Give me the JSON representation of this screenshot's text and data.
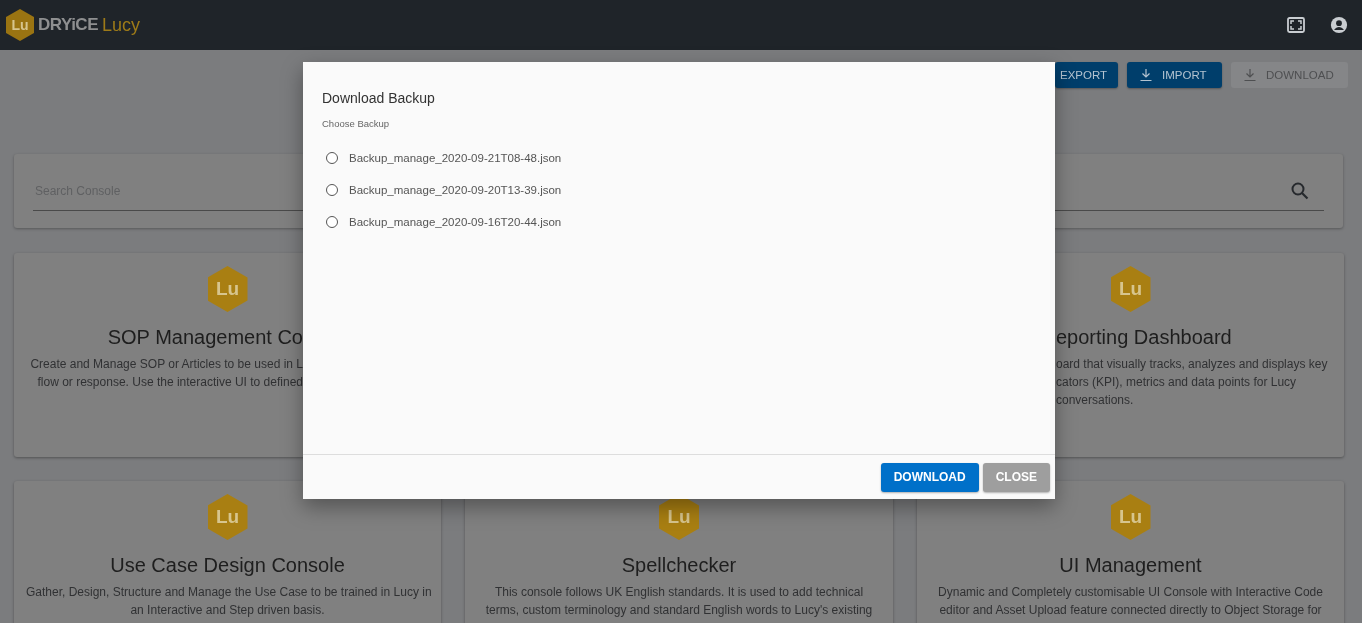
{
  "header": {
    "logo_text": "Lu",
    "brand": "DRYiCE",
    "product": "Lucy"
  },
  "toolbar": [
    {
      "label": "EXPORT",
      "kind": "plain",
      "disabled": false
    },
    {
      "label": "IMPORT",
      "kind": "icon",
      "disabled": false
    },
    {
      "label": "DOWNLOAD",
      "kind": "icon",
      "disabled": true
    }
  ],
  "search": {
    "placeholder": "Search Console"
  },
  "cards_row_1": [
    {
      "logo_text": "Lu",
      "title": "SOP Management Co",
      "description_lines": [
        "Create and Manage SOP or Articles to be used in L",
        "flow or response. Use the interactive UI to defined"
      ]
    },
    {
      "logo_text": "Lu",
      "title": "eporting Dashboard",
      "description_lines": [
        "oard that visually tracks, analyzes and displays key",
        "cators (KPI), metrics and data points for Lucy",
        "conversations."
      ]
    }
  ],
  "cards_row_2": [
    {
      "logo_text": "Lu",
      "title": "Use Case Design Console",
      "description_lines": [
        "Gather, Design, Structure and Manage the Use Case to be trained in Lucy in",
        "an Interactive and Step driven basis."
      ]
    },
    {
      "logo_text": "Lu",
      "title": "Spellchecker",
      "description_lines": [
        "This console follows UK English standards. It is used to add technical",
        "terms, custom terminology and standard English words to Lucy's existing"
      ]
    },
    {
      "logo_text": "Lu",
      "title": "UI Management",
      "description_lines": [
        "Dynamic and Completely customisable UI Console with Interactive Code",
        "editor and Asset Upload feature connected directly to Object Storage for"
      ]
    }
  ],
  "dialog": {
    "title": "Download Backup",
    "label": "Choose Backup",
    "options": [
      {
        "label": "Backup_manage_2020-09-21T08-48.json",
        "selected": false
      },
      {
        "label": "Backup_manage_2020-09-20T13-39.json",
        "selected": false
      },
      {
        "label": "Backup_manage_2020-09-16T20-44.json",
        "selected": false
      }
    ],
    "buttons": [
      {
        "label": "DOWNLOAD",
        "kind": "primary"
      },
      {
        "label": "CLOSE",
        "kind": "secondary"
      }
    ]
  }
}
